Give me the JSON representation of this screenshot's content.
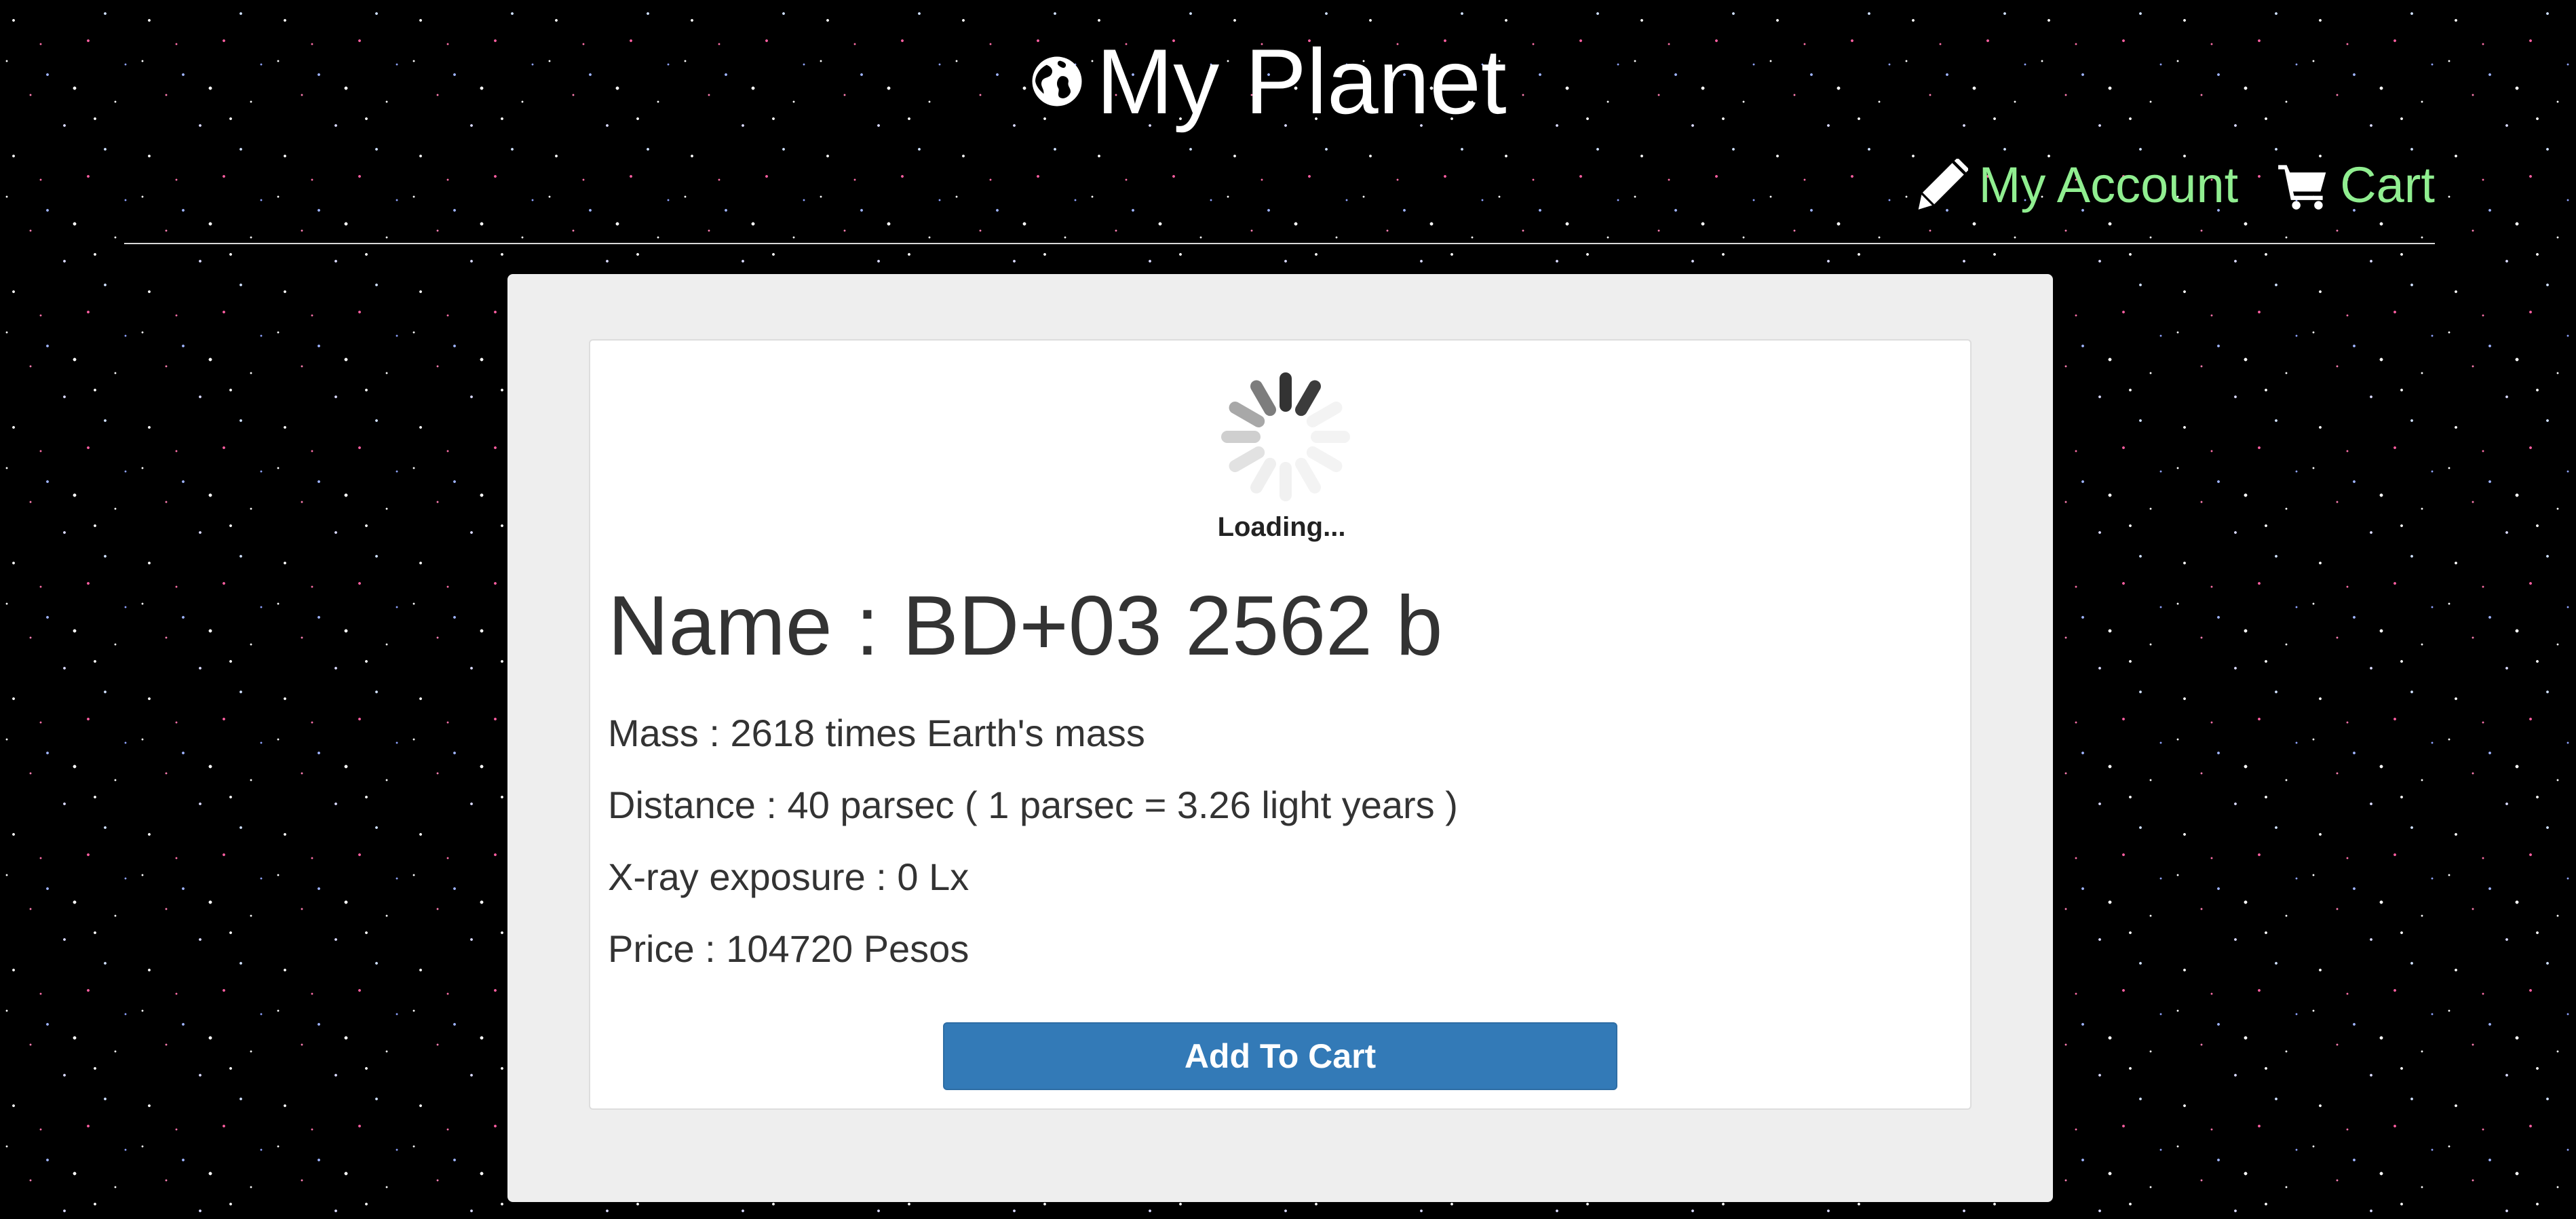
{
  "site": {
    "title": "My Planet",
    "logo_icon": "globe-icon"
  },
  "nav": {
    "account_label": "My Account",
    "account_icon": "pencil-icon",
    "cart_label": "Cart",
    "cart_icon": "cart-icon",
    "link_color": "#90ee90"
  },
  "product": {
    "loading_text": "Loading...",
    "name_line": "Name : BD+03 2562 b",
    "mass_line": "Mass : 2618 times Earth's mass",
    "distance_line": "Distance : 40 parsec ( 1 parsec = 3.26 light years )",
    "xray_line": "X-ray exposure : 0 Lx",
    "price_line": "Price : 104720 Pesos",
    "add_to_cart_label": "Add To Cart",
    "button_color": "#337ab7"
  }
}
